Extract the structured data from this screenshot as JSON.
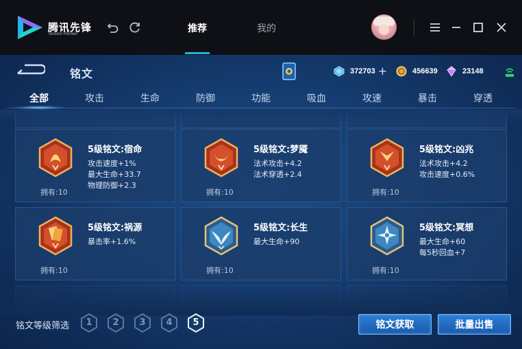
{
  "app": {
    "brand_name": "腾讯先锋",
    "brand_sub": "Tencent Pioneer",
    "nav_tabs": [
      {
        "label": "推荐",
        "active": true
      },
      {
        "label": "我的",
        "active": false
      }
    ]
  },
  "game": {
    "page_title": "铭文",
    "currencies": [
      {
        "name": "diamond",
        "icon": "gem-icon",
        "value": "372703",
        "has_plus": true
      },
      {
        "name": "gold",
        "icon": "gold-coin-icon",
        "value": "456639"
      },
      {
        "name": "crystal",
        "icon": "purple-crystal-icon",
        "value": "23148"
      }
    ],
    "category_tabs": [
      "全部",
      "攻击",
      "生命",
      "防御",
      "功能",
      "吸血",
      "攻速",
      "暴击",
      "穿透"
    ],
    "active_tab": "全部",
    "inscriptions": [
      {
        "name": "5级铭文:宿命",
        "color": "red",
        "stats": [
          "攻击速度+1%",
          "最大生命+33.7",
          "物理防御+2.3"
        ],
        "owned": "拥有:10"
      },
      {
        "name": "5级铭文:梦魇",
        "color": "red",
        "stats": [
          "法术攻击+4.2",
          "法术穿透+2.4"
        ],
        "owned": "拥有:10"
      },
      {
        "name": "5级铭文:凶兆",
        "color": "red",
        "stats": [
          "法术攻击+4.2",
          "攻击速度+0.6%"
        ],
        "owned": "拥有:10"
      },
      {
        "name": "5级铭文:祸源",
        "color": "red",
        "stats": [
          "暴击率+1.6%"
        ],
        "owned": "拥有:10"
      },
      {
        "name": "5级铭文:长生",
        "color": "blue",
        "stats": [
          "最大生命+90"
        ],
        "owned": "拥有:10"
      },
      {
        "name": "5级铭文:冥想",
        "color": "blue",
        "stats": [
          "最大生命+60",
          "每5秒回血+7"
        ],
        "owned": "拥有:10"
      }
    ],
    "footer": {
      "filter_label": "铭文等级筛选",
      "levels": [
        "1",
        "2",
        "3",
        "4",
        "5"
      ],
      "active_level": "5",
      "obtain_button": "铭文获取",
      "bulk_sell_button": "批量出售"
    },
    "colors": {
      "accent": "#19b6d8",
      "panel_bg": "#153c6f",
      "card_bg": "#1b3d6b",
      "button_bg": "#2b7fd6"
    }
  }
}
